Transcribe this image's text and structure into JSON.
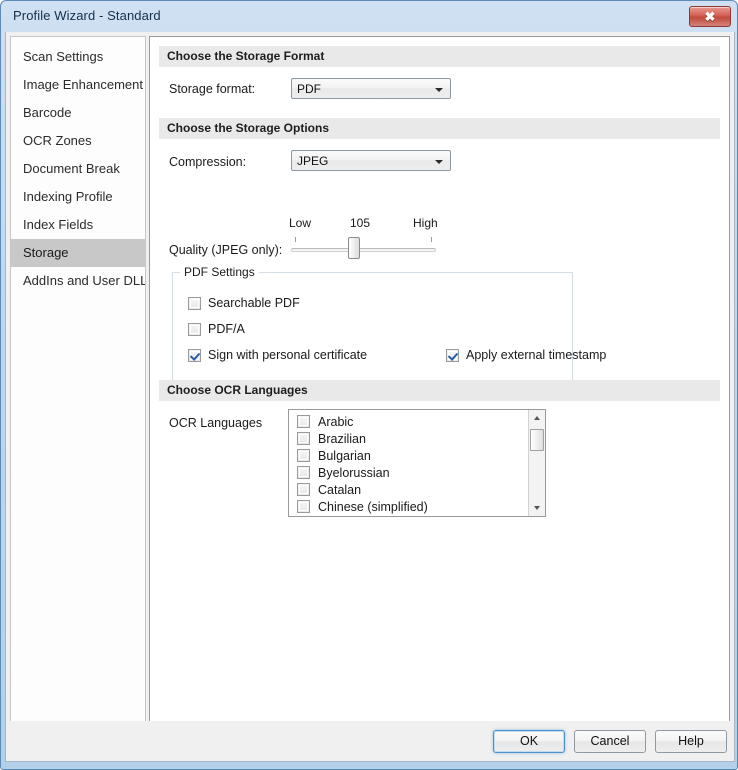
{
  "window": {
    "title": "Profile Wizard - Standard",
    "close_label": "✖"
  },
  "sidebar": {
    "items": [
      {
        "label": "Scan Settings",
        "selected": false
      },
      {
        "label": "Image Enhancement",
        "selected": false
      },
      {
        "label": "Barcode",
        "selected": false
      },
      {
        "label": "OCR Zones",
        "selected": false
      },
      {
        "label": "Document Break",
        "selected": false
      },
      {
        "label": "Indexing Profile",
        "selected": false
      },
      {
        "label": "Index Fields",
        "selected": false
      },
      {
        "label": "Storage",
        "selected": true
      },
      {
        "label": "AddIns and User DLLs",
        "selected": false
      }
    ]
  },
  "sections": {
    "storage_format": {
      "header": "Choose the Storage Format",
      "format_label": "Storage format:",
      "format_value": "PDF"
    },
    "storage_options": {
      "header": "Choose the Storage Options",
      "compression_label": "Compression:",
      "compression_value": "JPEG",
      "quality_label": "Quality (JPEG only):",
      "quality_low": "Low",
      "quality_high": "High",
      "quality_value": "105",
      "pdf_settings": {
        "title": "PDF Settings",
        "checkboxes": [
          {
            "label": "Searchable PDF",
            "checked": false
          },
          {
            "label": "PDF/A",
            "checked": false
          },
          {
            "label": "Sign with personal certificate",
            "checked": true
          },
          {
            "label": "Apply external timestamp",
            "checked": true
          }
        ]
      }
    },
    "ocr_languages": {
      "header": "Choose OCR Languages",
      "label": "OCR Languages",
      "items": [
        {
          "label": "Arabic",
          "checked": false
        },
        {
          "label": "Brazilian",
          "checked": false
        },
        {
          "label": "Bulgarian",
          "checked": false
        },
        {
          "label": "Byelorussian",
          "checked": false
        },
        {
          "label": "Catalan",
          "checked": false
        },
        {
          "label": "Chinese (simplified)",
          "checked": false
        }
      ]
    }
  },
  "buttons": {
    "ok": "OK",
    "cancel": "Cancel",
    "help": "Help"
  },
  "colors": {
    "titlebar": "#bcd6ee",
    "selection": "#c8c8c8",
    "section_header": "#e9e9e9",
    "check_mark": "#2a5da8",
    "close_button": "#c24a3c"
  }
}
